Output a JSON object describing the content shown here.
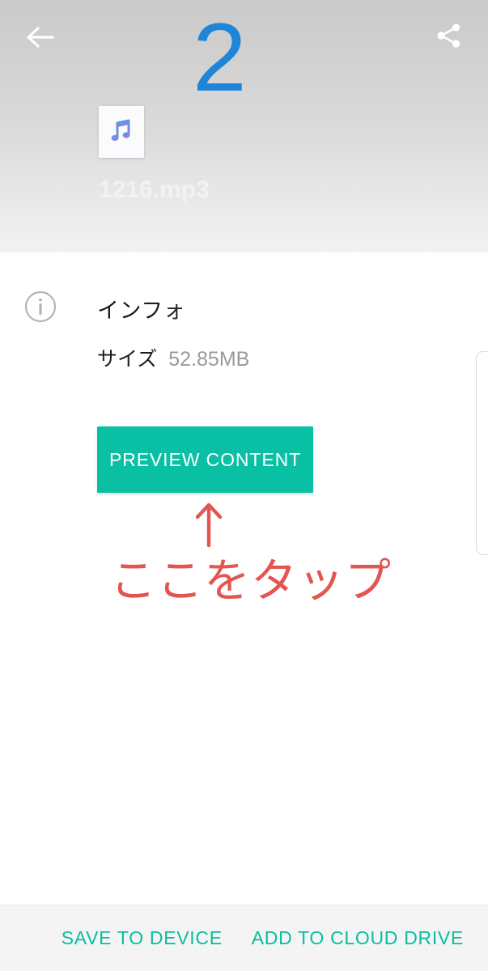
{
  "header": {
    "back_icon": "back-arrow-icon",
    "share_icon": "share-icon",
    "file_name": "1216.mp3",
    "thumbnail_icon": "music-note-icon",
    "background_top_color": "#cacaca",
    "background_bottom_color": "#f1f1f1"
  },
  "info": {
    "icon": "info-circle-icon",
    "title": "インフォ",
    "size_label": "サイズ",
    "size_value": "52.85MB"
  },
  "actions": {
    "preview_label": "PREVIEW CONTENT",
    "preview_color": "#0ac0a4"
  },
  "annotations": {
    "step_number": "2",
    "step_number_color": "#1e85d8",
    "arrow_icon": "up-arrow-annotation-icon",
    "tap_here_text": "ここをタップ",
    "annotation_color": "#e3564f"
  },
  "bottom_bar": {
    "save_to_device_label": "SAVE TO DEVICE",
    "add_to_cloud_drive_label": "ADD TO CLOUD DRIVE",
    "action_color": "#09bda1"
  }
}
